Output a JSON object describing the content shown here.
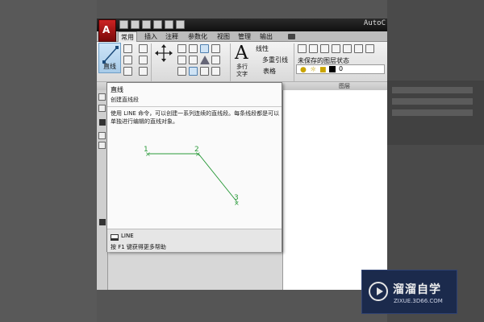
{
  "window": {
    "title": "AutoC",
    "logo_letter": "A"
  },
  "ribbon_tabs": [
    "常用",
    "插入",
    "注释",
    "参数化",
    "视图",
    "管理",
    "输出"
  ],
  "ribbon": {
    "line_button": "直线",
    "move_button": "移动",
    "multiline_text": "多行\n文字",
    "linear_dim": "线性",
    "multileader": "多重引线",
    "table": "表格",
    "layer_state": "未保存的图层状态",
    "current_layer": "0",
    "layer_group_title": "图层"
  },
  "tooltip": {
    "title": "直线",
    "subtitle": "创建直线段",
    "description": "使用 LINE 命令，可以创建一系列连续的直线段。每条线段都是可以单独进行编辑的直线对象。",
    "points": [
      "1",
      "2",
      "3"
    ],
    "command": "LINE",
    "help_hint": "按 F1 键获得更多帮助"
  },
  "colors": {
    "accent_blue": "#a8cbe8",
    "point_green": "#2a9a3a",
    "logo_red": "#c22222"
  },
  "watermark": {
    "name_cn": "溜溜自学",
    "name_en": "ZIXUE.3D66.COM"
  }
}
